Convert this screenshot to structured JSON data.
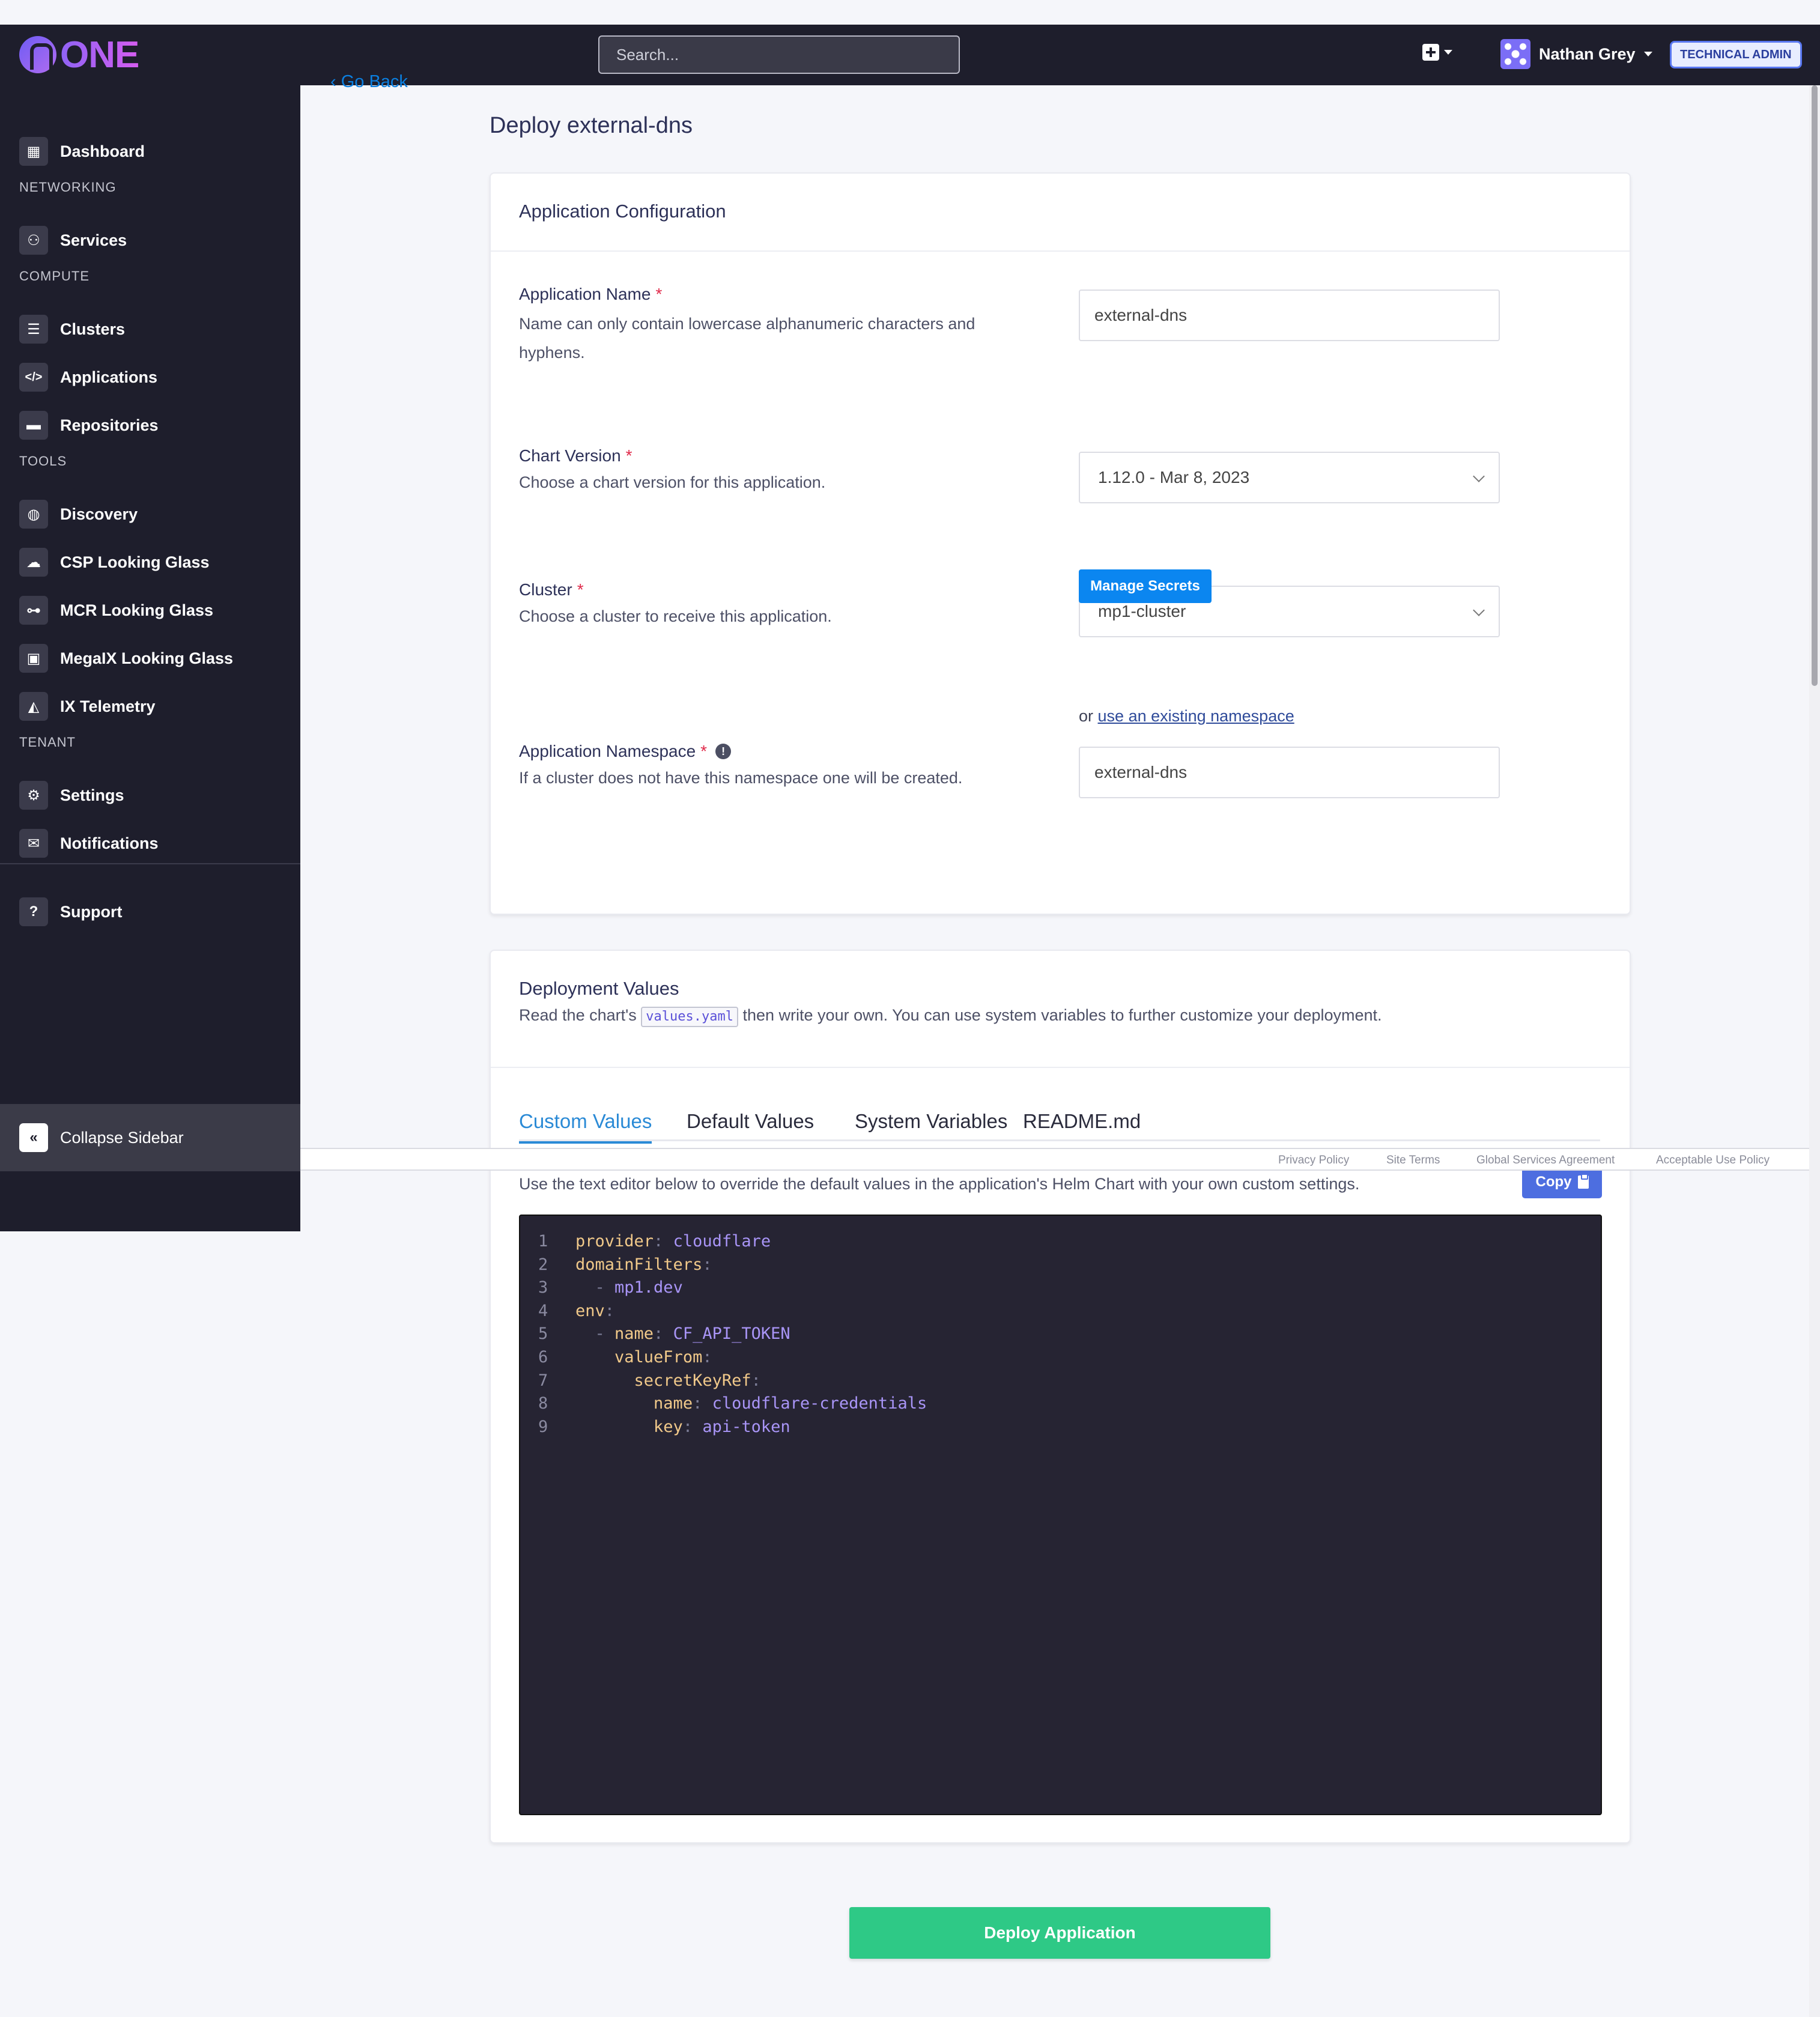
{
  "app": {
    "logo_text": "ONE"
  },
  "header": {
    "search_placeholder": "Search...",
    "user_name": "Nathan Grey",
    "role_badge": "TECHNICAL ADMIN"
  },
  "sidebar": {
    "dashboard": "Dashboard",
    "sections": {
      "networking": "NETWORKING",
      "compute": "COMPUTE",
      "tools": "TOOLS",
      "tenant": "TENANT"
    },
    "items": {
      "services": "Services",
      "clusters": "Clusters",
      "applications": "Applications",
      "repositories": "Repositories",
      "discovery": "Discovery",
      "csp_looking_glass": "CSP Looking Glass",
      "mcr_looking_glass": "MCR Looking Glass",
      "megaix_looking_glass": "MegaIX Looking Glass",
      "ix_telemetry": "IX Telemetry",
      "settings": "Settings",
      "notifications": "Notifications",
      "support": "Support"
    },
    "collapse_label": "Collapse Sidebar"
  },
  "page": {
    "go_back": "Go Back",
    "title": "Deploy external-dns"
  },
  "config": {
    "heading": "Application Configuration",
    "app_name": {
      "label": "Application Name",
      "help": "Name can only contain lowercase alphanumeric characters and hyphens.",
      "value": "external-dns"
    },
    "chart_version": {
      "label": "Chart Version",
      "help": "Choose a chart version for this application.",
      "value": "1.12.0 - Mar 8, 2023"
    },
    "cluster": {
      "label": "Cluster",
      "help": "Choose a cluster to receive this application.",
      "value": "mp1-cluster",
      "manage_secrets": "Manage Secrets"
    },
    "namespace": {
      "label": "Application Namespace",
      "help": "If a cluster does not have this namespace one will be created.",
      "value": "external-dns",
      "or_text": "or",
      "existing_link": "use an existing namespace"
    },
    "required_mark": "*"
  },
  "deployment": {
    "heading": "Deployment Values",
    "desc_before": "Read the chart's",
    "desc_code": "values.yaml",
    "desc_after": "then write your own. You can use system variables to further customize your deployment.",
    "tabs": [
      "Custom Values",
      "Default Values",
      "System Variables",
      "README.md"
    ],
    "active_tab": "Custom Values",
    "editor_help": "Use the text editor below to override the default values in the application's Helm Chart with your own custom settings.",
    "copy_label": "Copy",
    "code_lines": [
      {
        "num": "1",
        "indent": "",
        "dash": "",
        "key": "provider",
        "value": "cloudflare"
      },
      {
        "num": "2",
        "indent": "",
        "dash": "",
        "key": "domainFilters",
        "value": ""
      },
      {
        "num": "3",
        "indent": "  ",
        "dash": "- ",
        "key": "",
        "value": "mp1.dev"
      },
      {
        "num": "4",
        "indent": "",
        "dash": "",
        "key": "env",
        "value": ""
      },
      {
        "num": "5",
        "indent": "  ",
        "dash": "- ",
        "key": "name",
        "value": "CF_API_TOKEN"
      },
      {
        "num": "6",
        "indent": "    ",
        "dash": "",
        "key": "valueFrom",
        "value": ""
      },
      {
        "num": "7",
        "indent": "      ",
        "dash": "",
        "key": "secretKeyRef",
        "value": ""
      },
      {
        "num": "8",
        "indent": "        ",
        "dash": "",
        "key": "name",
        "value": "cloudflare-credentials"
      },
      {
        "num": "9",
        "indent": "        ",
        "dash": "",
        "key": "key",
        "value": "api-token"
      }
    ]
  },
  "footer": {
    "links": [
      "Privacy Policy",
      "Site Terms",
      "Global Services Agreement",
      "Acceptable Use Policy"
    ]
  },
  "deploy_button": "Deploy Application",
  "colors": {
    "sidebar_bg": "#1e1e2c",
    "accent_blue": "#0b86f0",
    "deploy_green": "#2ec986",
    "required_red": "#e02a4a"
  }
}
